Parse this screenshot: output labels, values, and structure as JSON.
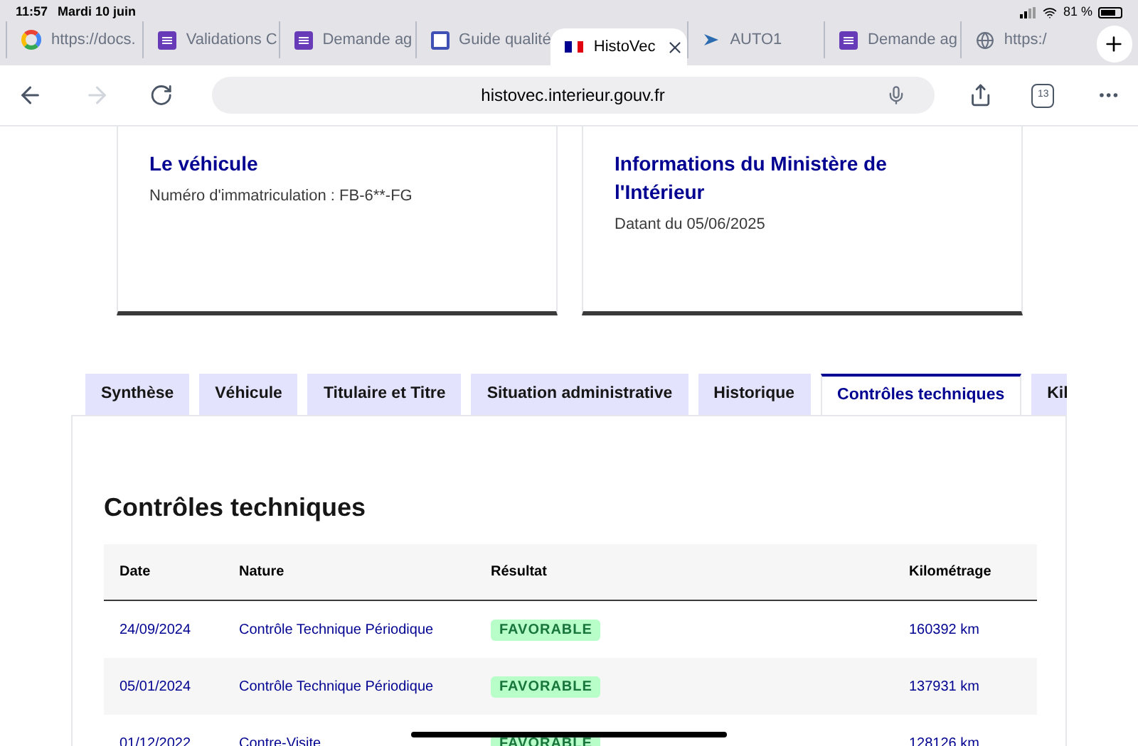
{
  "status_bar": {
    "time": "11:57",
    "date": "Mardi 10 juin",
    "battery": "81 %"
  },
  "browser_tabs": [
    {
      "title": "https://docs.",
      "kind": "google",
      "selected": false
    },
    {
      "title": "Validations C",
      "kind": "form",
      "selected": false
    },
    {
      "title": "Demande ag",
      "kind": "form",
      "selected": false
    },
    {
      "title": "Guide qualité",
      "kind": "site",
      "selected": false
    },
    {
      "title": "HistoVec",
      "kind": "flag",
      "selected": true
    },
    {
      "title": "AUTO1",
      "kind": "auto",
      "selected": false
    },
    {
      "title": "Demande ag",
      "kind": "form",
      "selected": false
    },
    {
      "title": "https:/",
      "kind": "globe",
      "selected": false
    }
  ],
  "toolbar": {
    "url": "histovec.interieur.gouv.fr",
    "tab_count": "13"
  },
  "cards": [
    {
      "title": "Le véhicule",
      "text": "Numéro d'immatriculation : FB-6**-FG"
    },
    {
      "title": "Informations du Ministère de l'Intérieur",
      "text": "Datant du 05/06/2025"
    }
  ],
  "tabs": [
    {
      "label": "Synthèse",
      "selected": false
    },
    {
      "label": "Véhicule",
      "selected": false
    },
    {
      "label": "Titulaire et Titre",
      "selected": false
    },
    {
      "label": "Situation administrative",
      "selected": false
    },
    {
      "label": "Historique",
      "selected": false
    },
    {
      "label": "Contrôles techniques",
      "selected": true
    },
    {
      "label": "Kil",
      "selected": false
    }
  ],
  "section": {
    "title": "Contrôles techniques",
    "table": {
      "columns": [
        "Date",
        "Nature",
        "Résultat",
        "Kilométrage"
      ],
      "rows": [
        {
          "date": "24/09/2024",
          "nature": "Contrôle Technique Périodique",
          "result": "FAVORABLE",
          "mileage": "160392 km"
        },
        {
          "date": "05/01/2024",
          "nature": "Contrôle Technique Périodique",
          "result": "FAVORABLE",
          "mileage": "137931 km"
        },
        {
          "date": "01/12/2022",
          "nature": "Contre-Visite",
          "result": "FAVORABLE",
          "mileage": "128126 km"
        }
      ]
    }
  }
}
